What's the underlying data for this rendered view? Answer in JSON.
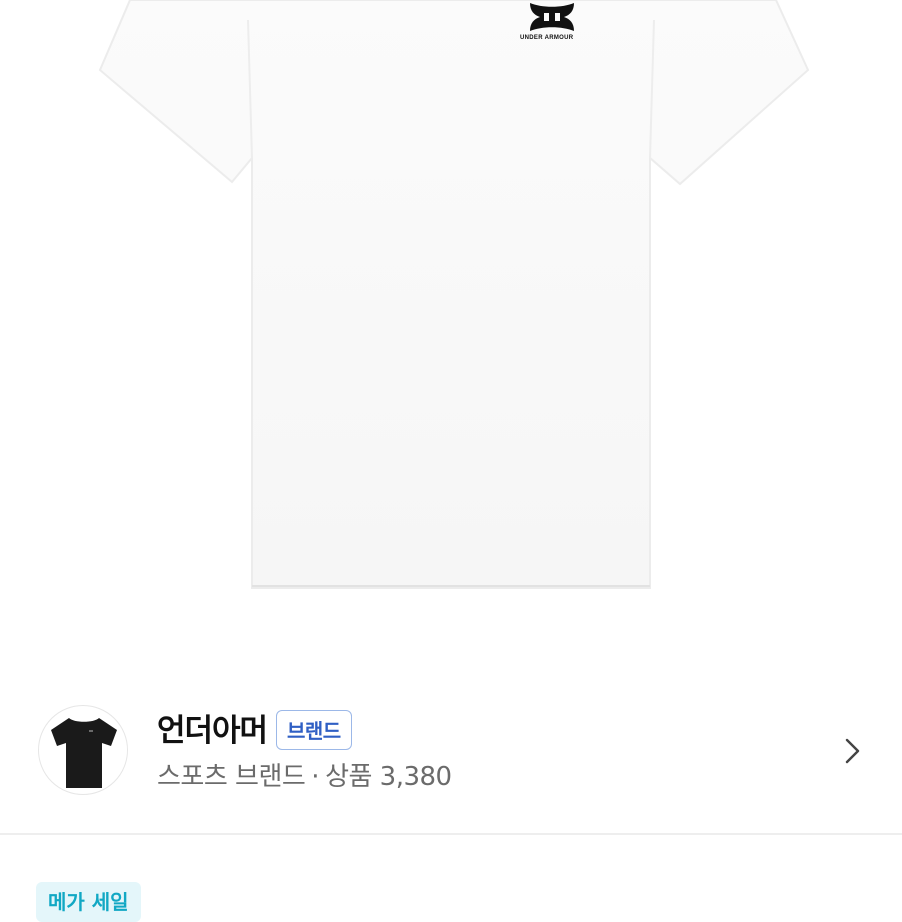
{
  "product": {
    "image_icon": "white-tshirt-image",
    "logo_text": "UNDER ARMOUR"
  },
  "brand": {
    "name": "언더아머",
    "badge": "브랜드",
    "category": "스포츠 브랜드",
    "separator": "·",
    "products_label": "상품 3,380",
    "avatar_icon": "black-tshirt-icon",
    "chevron_icon": "chevron-right-icon",
    "badge_color": "#2f5fc4"
  },
  "promo": {
    "tag_label": "메가 세일",
    "tag_color": "#11a8c4"
  }
}
